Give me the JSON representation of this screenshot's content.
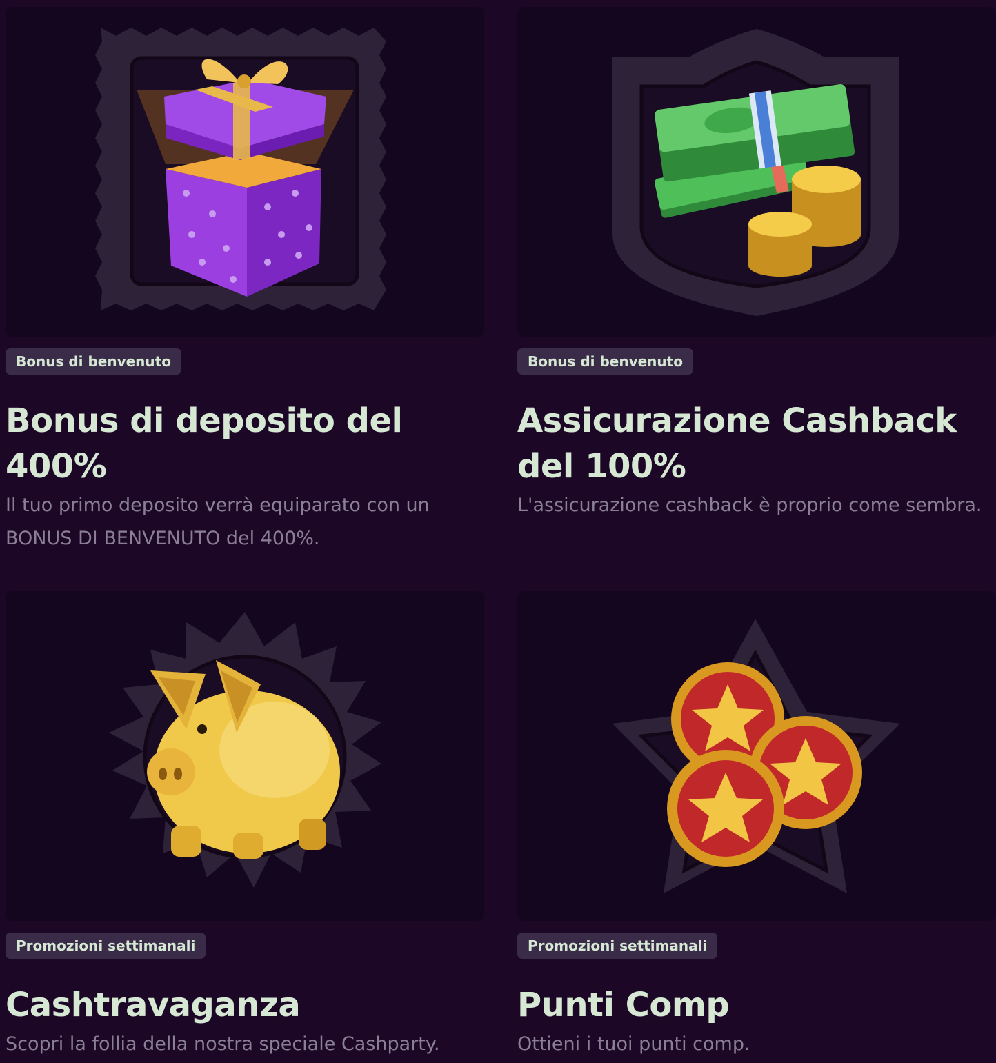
{
  "promotions": [
    {
      "category": "Bonus di benvenuto",
      "title": "Bonus di deposito del 400%",
      "description": "Il tuo primo deposito verrà equiparato con un BONUS DI BENVENUTO del 400%.",
      "icon": "gift-box-icon"
    },
    {
      "category": "Bonus di benvenuto",
      "title": "Assicurazione Cashback del 100%",
      "description": "L'assicurazione cashback è proprio come sembra.",
      "icon": "money-stack-icon"
    },
    {
      "category": "Promozioni settimanali",
      "title": "Cashtravaganza",
      "description": "Scopri la follia della nostra speciale Cashparty.",
      "icon": "piggy-bank-icon"
    },
    {
      "category": "Promozioni settimanali",
      "title": "Punti Comp",
      "description": "Ottieni i tuoi punti comp.",
      "icon": "star-coins-icon"
    }
  ],
  "colors": {
    "background": "#1c0826",
    "card": "#150620",
    "badge": "#3a2c48",
    "title": "#d6e8d4",
    "description": "#8a7f95"
  }
}
